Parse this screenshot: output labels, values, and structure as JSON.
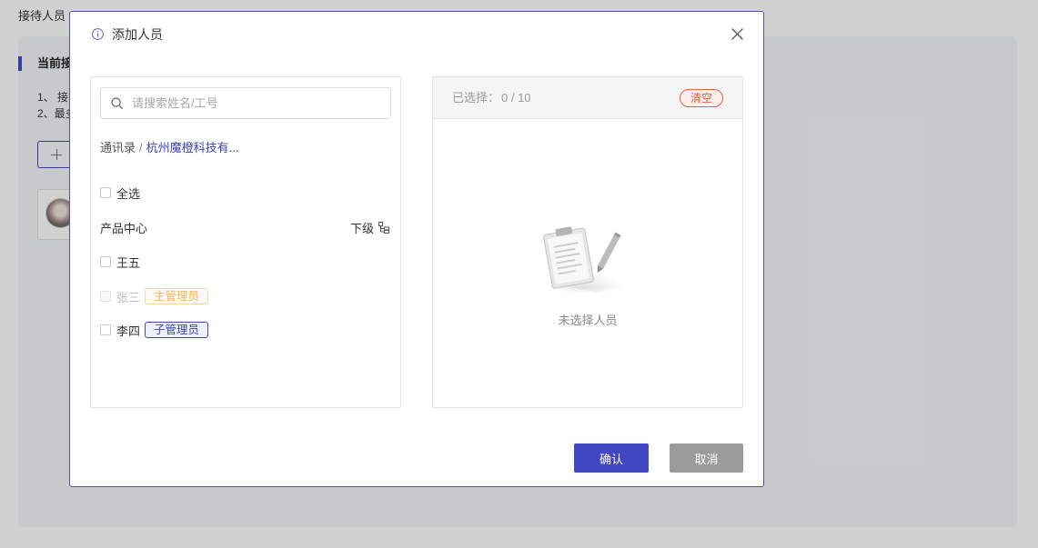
{
  "page": {
    "header_label": "接待人员",
    "section_title": "当前接",
    "rules": [
      "1、 接",
      "2、最多"
    ]
  },
  "modal": {
    "title": "添加人员",
    "left": {
      "search_placeholder": "请搜索姓名/工号",
      "breadcrumb_root": "通讯录",
      "breadcrumb_sep": "/",
      "breadcrumb_current": "杭州魔橙科技有...",
      "select_all_label": "全选",
      "department_name": "产品中心",
      "sub_level_label": "下级",
      "members": [
        {
          "name": "王五",
          "disabled": false
        },
        {
          "name": "张三",
          "tag": "主管理员",
          "disabled": true
        },
        {
          "name": "李四",
          "tag": "子管理员",
          "disabled": false
        }
      ]
    },
    "right": {
      "selected_label": "已选择：",
      "selected_count": "0 / 10",
      "clear_label": "清空",
      "empty_text": "未选择人员"
    },
    "footer": {
      "confirm_label": "确认",
      "cancel_label": "取消"
    }
  },
  "icons": {
    "title": "info-icon",
    "close": "close-icon",
    "search": "search-icon",
    "sub_level": "org-tree-icon",
    "empty_state": "empty-clipboard-icon",
    "empty_state_pencil": "pencil-icon",
    "add": "plus-icon",
    "member_avatar": "avatar"
  },
  "colors": {
    "accent": "#4248c2",
    "clear_tag": "#e5603f",
    "primary_admin_tag": "#f1b46a",
    "cancel_button": "#9b9b9b"
  }
}
